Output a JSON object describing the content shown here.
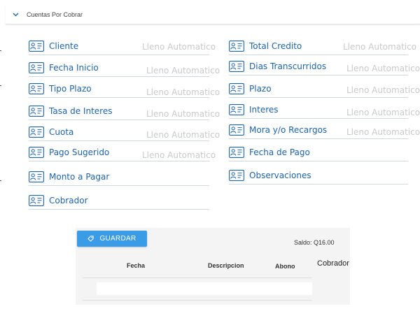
{
  "header": {
    "title": "Cuentas Por Cobrar"
  },
  "form": {
    "left": [
      {
        "label": "Cliente",
        "placeholder": "Lleno Automatico"
      },
      {
        "label": "Fecha Inicio",
        "placeholder": "Lleno Automatico"
      },
      {
        "label": "Tipo Plazo",
        "placeholder": "Lleno Automatico"
      },
      {
        "label": "Tasa de Interes",
        "placeholder": "Lleno Automatico"
      },
      {
        "label": "Cuota",
        "placeholder": "Lleno Automatico"
      },
      {
        "label": "Pago Sugerido",
        "placeholder": "Lleno Automatico"
      },
      {
        "label": "Monto a Pagar"
      },
      {
        "label": "Cobrador"
      }
    ],
    "right": [
      {
        "label": "Total Credito",
        "placeholder": "Lleno Automatico"
      },
      {
        "label": "Dias Transcurridos",
        "placeholder": "Lleno Automatico"
      },
      {
        "label": "Plazo",
        "placeholder": "Lleno Automatico"
      },
      {
        "label": "Interes",
        "placeholder": "Lleno Automatico"
      },
      {
        "label": "Mora y/o Recargos",
        "placeholder": "Lleno Automatico"
      },
      {
        "label": "Fecha de Pago"
      },
      {
        "label": "Observaciones"
      }
    ]
  },
  "actions": {
    "save_label": "GUARDAR"
  },
  "summary": {
    "saldo": "Saldo: Q16.00"
  },
  "table": {
    "columns": [
      "Fecha",
      "Descripcion",
      "Abono",
      "Cobrador"
    ]
  },
  "colors": {
    "accent": "#3a9be6",
    "label": "#1f63a8",
    "placeholder": "#c9c9c9"
  },
  "icons": {
    "field": "contact-card-icon",
    "button": "tag-icon",
    "header": "chevron-down-icon"
  }
}
